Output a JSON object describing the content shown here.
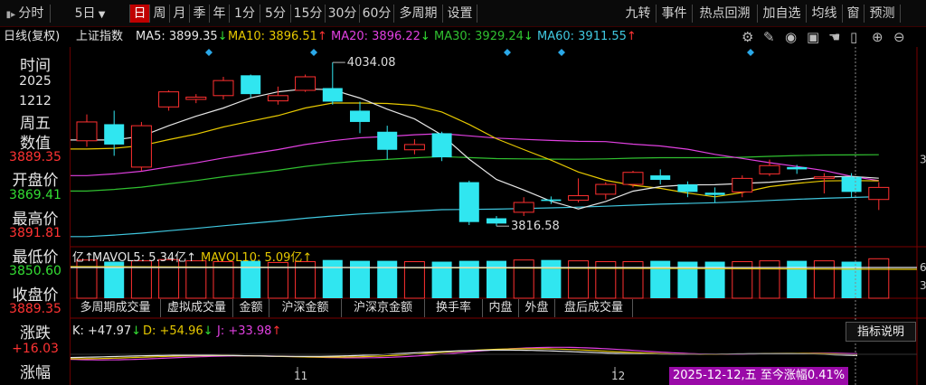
{
  "toolbar": {
    "left_items": [
      {
        "label": "分时",
        "icon": "menu-arrow-icon"
      },
      {
        "label": "5日"
      },
      {
        "label": "日",
        "active": true
      },
      {
        "label": "周"
      },
      {
        "label": "月"
      },
      {
        "label": "季"
      },
      {
        "label": "年"
      },
      {
        "label": "1分"
      },
      {
        "label": "5分"
      },
      {
        "label": "15分"
      },
      {
        "label": "30分"
      },
      {
        "label": "60分"
      },
      {
        "label": "多周期"
      },
      {
        "label": "设置"
      }
    ],
    "right_items": [
      "九转",
      "事件",
      "热点回溯",
      "加自选",
      "均线",
      "窗",
      "预测"
    ]
  },
  "info": {
    "mode": "日线(复权)",
    "index_name": "上证指数",
    "ma5": {
      "label": "MA5: 3899.35",
      "arrow": "↓",
      "color": "#e6e6e6"
    },
    "ma10": {
      "label": "MA10: 3896.51",
      "arrow": "↑",
      "color": "#e6c800"
    },
    "ma20": {
      "label": "MA20: 3896.22",
      "arrow": "↓",
      "color": "#e040e0"
    },
    "ma30": {
      "label": "MA30: 3929.24",
      "arrow": "↓",
      "color": "#30c030"
    },
    "ma60": {
      "label": "MA60: 3911.55",
      "arrow": "↑",
      "color": "#40c8e0"
    },
    "tool_icons": [
      "gear-icon",
      "pen-icon",
      "eye-icon",
      "toolbox-icon",
      "hand-icon",
      "trash-icon",
      "zoom-in-icon",
      "zoom-out-icon"
    ]
  },
  "left_panel": {
    "time_label": "时间",
    "year": "2025",
    "date": "1212",
    "weekday": "周五",
    "value_label": "数值",
    "value": "3889.35",
    "open_label": "开盘价",
    "open": "3869.41",
    "high_label": "最高价",
    "high": "3891.81",
    "low_label": "最低价",
    "low": "3850.60",
    "close_label": "收盘价",
    "close": "3889.35",
    "change_label": "涨跌",
    "change": "+16.03",
    "pct_label": "涨幅",
    "colors": {
      "up": "#ff3333",
      "down": "#33dd33",
      "neutral": "#e6e6e6"
    }
  },
  "chart_data": {
    "type": "candlestick",
    "annotations": {
      "high": "4034.08",
      "low": "3816.58"
    },
    "price_axis_tick": "3",
    "volume_axis_ticks": [
      "6",
      "3"
    ],
    "colors": {
      "up": "#ff3030",
      "down": "#30e6f0",
      "ma5": "#e6e6e6",
      "ma10": "#e6c800",
      "ma20": "#e040e0",
      "ma30": "#30c030",
      "ma60": "#40c8e0"
    },
    "candles": [
      {
        "o": 3930,
        "c": 3955,
        "h": 3965,
        "l": 3922
      },
      {
        "o": 3952,
        "c": 3925,
        "h": 3970,
        "l": 3910
      },
      {
        "o": 3895,
        "c": 3950,
        "h": 3955,
        "l": 3890
      },
      {
        "o": 3975,
        "c": 3995,
        "h": 3997,
        "l": 3970
      },
      {
        "o": 3985,
        "c": 3988,
        "h": 3992,
        "l": 3980
      },
      {
        "o": 3990,
        "c": 4010,
        "h": 4015,
        "l": 3985
      },
      {
        "o": 4017,
        "c": 3992,
        "h": 4018,
        "l": 3987
      },
      {
        "o": 3983,
        "c": 3990,
        "h": 4002,
        "l": 3978
      },
      {
        "o": 3997,
        "c": 4015,
        "h": 4018,
        "l": 3995
      },
      {
        "o": 4000,
        "c": 3982,
        "h": 4034.08,
        "l": 3978
      },
      {
        "o": 3970,
        "c": 3955,
        "h": 3982,
        "l": 3940
      },
      {
        "o": 3942,
        "c": 3918,
        "h": 3950,
        "l": 3905
      },
      {
        "o": 3918,
        "c": 3925,
        "h": 3932,
        "l": 3912
      },
      {
        "o": 3940,
        "c": 3908,
        "h": 3942,
        "l": 3903
      },
      {
        "o": 3875,
        "c": 3822,
        "h": 3877,
        "l": 3818
      },
      {
        "o": 3827,
        "c": 3820,
        "h": 3830,
        "l": 3816.58
      },
      {
        "o": 3835,
        "c": 3848,
        "h": 3855,
        "l": 3830
      },
      {
        "o": 3852,
        "c": 3850,
        "h": 3856,
        "l": 3846
      },
      {
        "o": 3851,
        "c": 3857,
        "h": 3880,
        "l": 3848
      },
      {
        "o": 3859,
        "c": 3872,
        "h": 3875,
        "l": 3852
      },
      {
        "o": 3872,
        "c": 3888,
        "h": 3890,
        "l": 3868
      },
      {
        "o": 3884,
        "c": 3878,
        "h": 3892,
        "l": 3872
      },
      {
        "o": 3872,
        "c": 3862,
        "h": 3876,
        "l": 3855
      },
      {
        "o": 3861,
        "c": 3858,
        "h": 3868,
        "l": 3848
      },
      {
        "o": 3862,
        "c": 3880,
        "h": 3884,
        "l": 3855
      },
      {
        "o": 3886,
        "c": 3897,
        "h": 3905,
        "l": 3883
      },
      {
        "o": 3895,
        "c": 3892,
        "h": 3898,
        "l": 3886
      },
      {
        "o": 3880,
        "c": 3882,
        "h": 3887,
        "l": 3860
      },
      {
        "o": 3882,
        "c": 3862,
        "h": 3887,
        "l": 3855
      },
      {
        "o": 3852,
        "c": 3868,
        "h": 3875,
        "l": 3838
      }
    ],
    "volume_bars": [
      0.92,
      0.88,
      0.9,
      0.93,
      0.9,
      0.88,
      0.9,
      0.86,
      0.88,
      0.92,
      0.9,
      0.9,
      0.88,
      0.88,
      0.9,
      0.9,
      0.92,
      0.92,
      0.9,
      0.88,
      0.88,
      0.9,
      0.88,
      0.88,
      0.88,
      0.9,
      0.9,
      0.9,
      0.88,
      0.95
    ],
    "volume_line_label": "亿↑",
    "mavol5": "MAVOL5: 5.34亿↑",
    "mavol10": "MAVOL10: 5.09亿↑",
    "x_ticks": [
      "11",
      "12"
    ]
  },
  "indicator_tabs": [
    "多周期成交量",
    "虚拟成交量",
    "金额",
    "沪深金额",
    "沪深京金额",
    "换手率",
    "内盘",
    "外盘",
    "盘后成交量"
  ],
  "indicator_explain": "指标说明",
  "kdj": {
    "k": {
      "label": "K: +47.97",
      "arrow": "↓",
      "color": "#e6e6e6"
    },
    "d": {
      "label": "D: +54.96",
      "arrow": "↓",
      "color": "#e6c800"
    },
    "j": {
      "label": "J: +33.98",
      "arrow": "↑",
      "color": "#e040e0"
    }
  },
  "date_badge": "2025-12-12,五 至今涨幅0.41%"
}
